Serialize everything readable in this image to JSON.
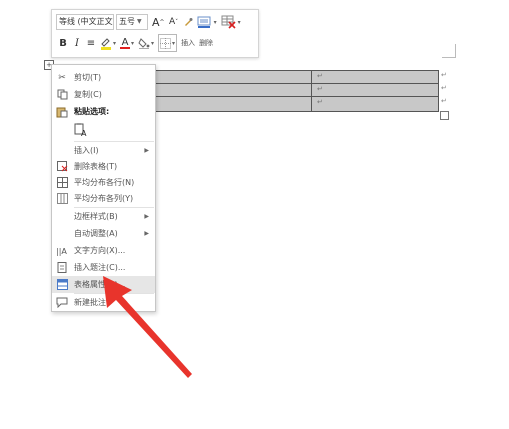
{
  "toolbar": {
    "font_name": "等线 (中文正文",
    "font_size": "五号",
    "grow_font": "A",
    "shrink_font": "A",
    "bold": "B",
    "italic": "I",
    "align": "≡",
    "font_color_letter": "A",
    "insert_label": "插入",
    "delete_label": "删除"
  },
  "table": {
    "cell_mark": "↵",
    "row_end_mark": "↵",
    "move_handle": "+"
  },
  "context_menu": {
    "items": [
      {
        "label": "剪切(T)",
        "icon": "scissors-icon"
      },
      {
        "label": "复制(C)",
        "icon": "copy-icon"
      },
      {
        "label": "粘贴选项:",
        "icon": "paste-icon"
      },
      {
        "label": "插入(I)",
        "icon": "",
        "submenu": true
      },
      {
        "label": "删除表格(T)",
        "icon": "delete-table-icon"
      },
      {
        "label": "平均分布各行(N)",
        "icon": "distribute-rows-icon"
      },
      {
        "label": "平均分布各列(Y)",
        "icon": "distribute-columns-icon"
      },
      {
        "label": "边框样式(B)",
        "icon": "",
        "submenu": true
      },
      {
        "label": "自动调整(A)",
        "icon": "",
        "submenu": true
      },
      {
        "label": "文字方向(X)...",
        "icon": "text-direction-icon"
      },
      {
        "label": "插入题注(C)...",
        "icon": "insert-caption-icon"
      },
      {
        "label": "表格属性(R)...",
        "icon": "table-properties-icon"
      },
      {
        "label": "新建批注",
        "icon": "new-comment-icon"
      }
    ]
  },
  "colors": {
    "arrow": "#e8342c",
    "table_fill": "#c8c8c8",
    "font_color_bar": "#e02020"
  }
}
